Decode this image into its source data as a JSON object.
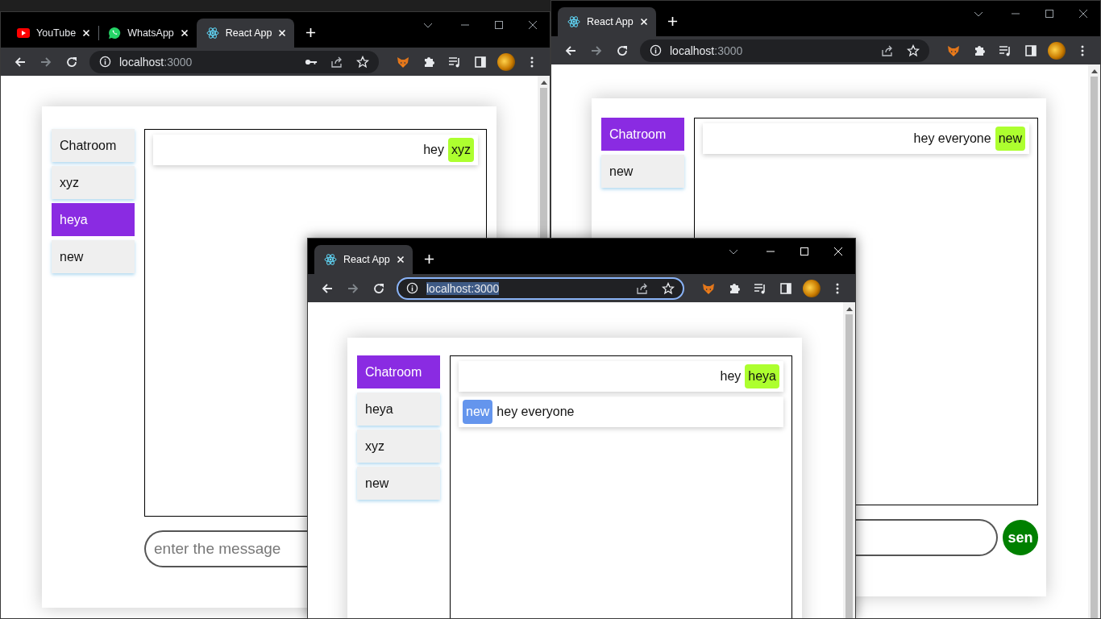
{
  "windows": [
    {
      "active": false,
      "tabs": [
        {
          "title": "YouTube",
          "kind": "play",
          "selected": false
        },
        {
          "title": "WhatsApp",
          "kind": "chat",
          "selected": false
        },
        {
          "title": "React App",
          "kind": "atom",
          "selected": true
        }
      ],
      "address": {
        "host": "localhost",
        "port": ":3000",
        "focused": false,
        "password_key": true
      },
      "page": {
        "rooms": [
          {
            "name": "Chatroom",
            "selected": false
          },
          {
            "name": "xyz",
            "selected": false
          },
          {
            "name": "heya",
            "selected": true
          },
          {
            "name": "new",
            "selected": false
          }
        ],
        "messages": [
          {
            "text": "hey",
            "sender": "xyz",
            "own": true,
            "color": "#adff2f"
          }
        ],
        "compose": {
          "placeholder": "enter the message"
        }
      }
    },
    {
      "active": false,
      "tabs": [
        {
          "title": "React App",
          "kind": "atom",
          "selected": true
        }
      ],
      "address": {
        "host": "localhost",
        "port": ":3000",
        "focused": false
      },
      "page": {
        "rooms": [
          {
            "name": "Chatroom",
            "selected": true
          },
          {
            "name": "new",
            "selected": false
          }
        ],
        "messages": [
          {
            "text": "hey everyone",
            "sender": "new",
            "own": true,
            "color": "#adff2f"
          }
        ],
        "compose": {
          "send_label": "sen"
        }
      }
    },
    {
      "active": true,
      "tabs": [
        {
          "title": "React App",
          "kind": "atom",
          "selected": true
        }
      ],
      "address": {
        "host": "localhost",
        "port": ":3000",
        "focused": true
      },
      "page": {
        "rooms": [
          {
            "name": "Chatroom",
            "selected": true
          },
          {
            "name": "heya",
            "selected": false
          },
          {
            "name": "xyz",
            "selected": false
          },
          {
            "name": "new",
            "selected": false
          }
        ],
        "messages": [
          {
            "text": "hey",
            "sender": "heya",
            "own": true,
            "color": "#adff2f"
          },
          {
            "text": "hey everyone",
            "sender": "new",
            "own": false,
            "color": "#6495ed"
          }
        ]
      }
    }
  ]
}
